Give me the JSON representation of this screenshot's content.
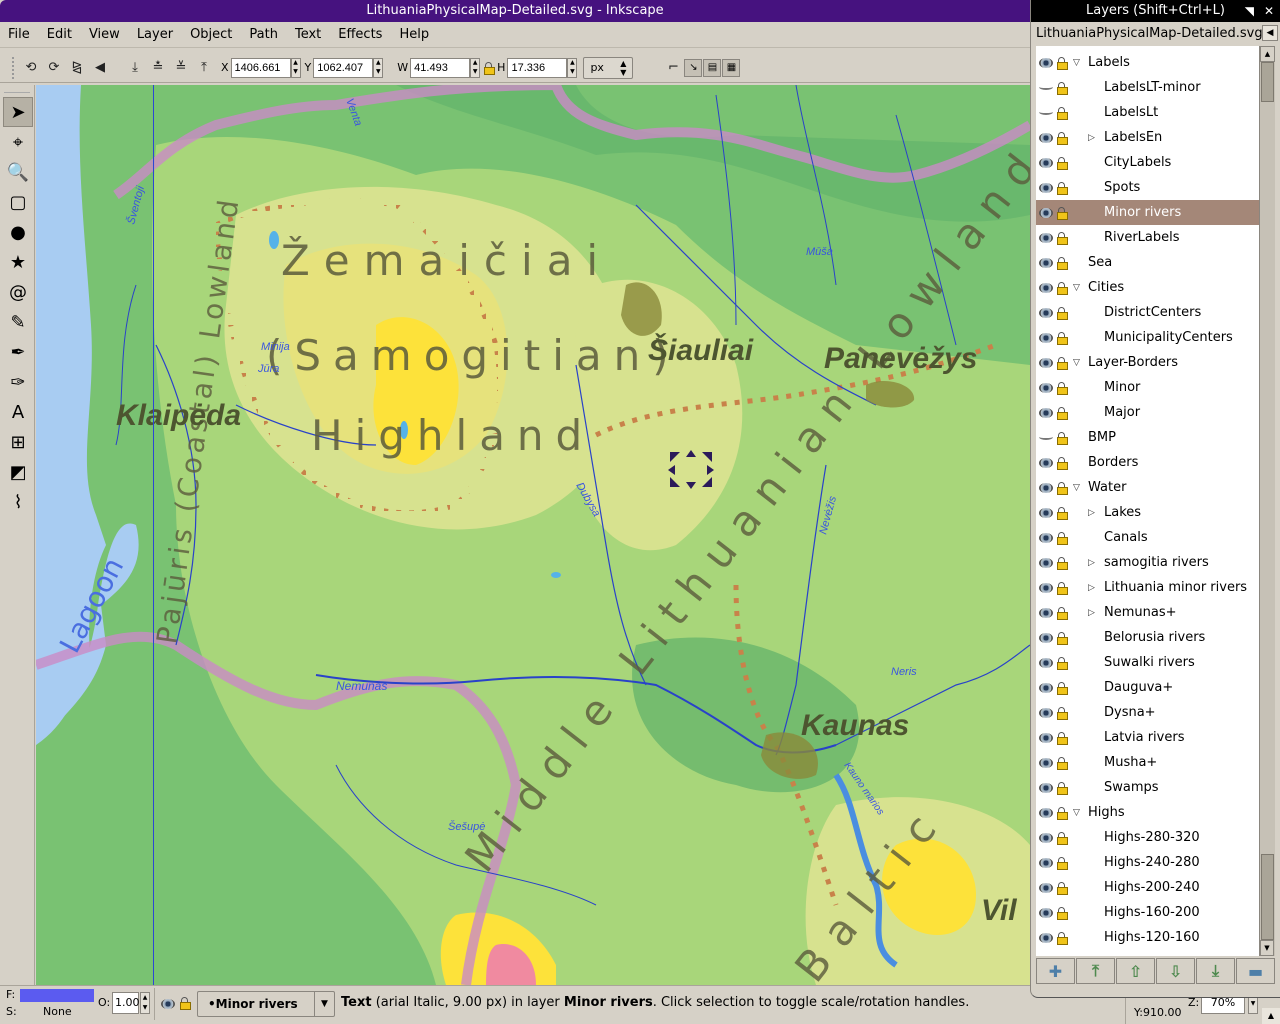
{
  "window": {
    "title": "LithuaniaPhysicalMap-Detailed.svg - Inkscape"
  },
  "menu": [
    {
      "label": "File",
      "accel": "F"
    },
    {
      "label": "Edit",
      "accel": "E"
    },
    {
      "label": "View",
      "accel": "V"
    },
    {
      "label": "Layer",
      "accel": "L"
    },
    {
      "label": "Object",
      "accel": "O"
    },
    {
      "label": "Path",
      "accel": "P"
    },
    {
      "label": "Text",
      "accel": "T"
    },
    {
      "label": "Effects",
      "accel": ""
    },
    {
      "label": "Help",
      "accel": "H"
    }
  ],
  "toolbar": {
    "x_label": "X",
    "x_value": "1406.661",
    "y_label": "Y",
    "y_value": "1062.407",
    "w_label": "W",
    "w_value": "41.493",
    "h_label": "H",
    "h_value": "17.336",
    "unit": "px",
    "transform_icons": [
      "rotate-ccw-icon",
      "rotate-cw-icon",
      "flip-horizontal-icon",
      "flip-vertical-icon"
    ],
    "zorder_icons": [
      "lower-to-bottom-icon",
      "lower-icon",
      "raise-icon",
      "raise-to-top-icon"
    ],
    "snap_icons": [
      "scale-stroke-icon",
      "scale-corners-icon",
      "scale-gradients-icon",
      "scale-patterns-icon"
    ]
  },
  "tools": [
    {
      "name": "selector-tool",
      "glyph": "➤",
      "active": true
    },
    {
      "name": "node-tool",
      "glyph": "⌖"
    },
    {
      "name": "zoom-tool",
      "glyph": "🔍"
    },
    {
      "name": "rectangle-tool",
      "glyph": "▢"
    },
    {
      "name": "ellipse-tool",
      "glyph": "●"
    },
    {
      "name": "star-tool",
      "glyph": "★"
    },
    {
      "name": "spiral-tool",
      "glyph": "@"
    },
    {
      "name": "pencil-tool",
      "glyph": "✎"
    },
    {
      "name": "pen-tool",
      "glyph": "✒"
    },
    {
      "name": "calligraphy-tool",
      "glyph": "✑"
    },
    {
      "name": "text-tool",
      "glyph": "A"
    },
    {
      "name": "connector-tool",
      "glyph": "⊞"
    },
    {
      "name": "gradient-tool",
      "glyph": "◩"
    },
    {
      "name": "dropper-tool",
      "glyph": "⌇"
    }
  ],
  "layers_dock": {
    "title": "Layers (Shift+Ctrl+L)",
    "document": "LithuaniaPhysicalMap-Detailed.svg",
    "layers": [
      {
        "name": "Labels",
        "level": 0,
        "expander": "open",
        "visible": true
      },
      {
        "name": "LabelsLT-minor",
        "level": 1,
        "expander": "",
        "visible": false
      },
      {
        "name": "LabelsLt",
        "level": 1,
        "expander": "",
        "visible": false
      },
      {
        "name": "LabelsEn",
        "level": 1,
        "expander": "closed",
        "visible": true
      },
      {
        "name": "CityLabels",
        "level": 1,
        "expander": "",
        "visible": true
      },
      {
        "name": "Spots",
        "level": 1,
        "expander": "",
        "visible": true
      },
      {
        "name": "Minor rivers",
        "level": 1,
        "expander": "",
        "visible": true,
        "selected": true
      },
      {
        "name": "RiverLabels",
        "level": 1,
        "expander": "",
        "visible": true
      },
      {
        "name": "Sea",
        "level": 0,
        "expander": "",
        "visible": true
      },
      {
        "name": "Cities",
        "level": 0,
        "expander": "open",
        "visible": true
      },
      {
        "name": "DistrictCenters",
        "level": 1,
        "expander": "",
        "visible": true
      },
      {
        "name": "MunicipalityCenters",
        "level": 1,
        "expander": "",
        "visible": true
      },
      {
        "name": "Layer-Borders",
        "level": 0,
        "expander": "open",
        "visible": true
      },
      {
        "name": "Minor",
        "level": 1,
        "expander": "",
        "visible": true
      },
      {
        "name": "Major",
        "level": 1,
        "expander": "",
        "visible": true
      },
      {
        "name": "BMP",
        "level": 0,
        "expander": "",
        "visible": false
      },
      {
        "name": "Borders",
        "level": 0,
        "expander": "",
        "visible": true
      },
      {
        "name": "Water",
        "level": 0,
        "expander": "open",
        "visible": true
      },
      {
        "name": "Lakes",
        "level": 1,
        "expander": "closed",
        "visible": true
      },
      {
        "name": "Canals",
        "level": 1,
        "expander": "",
        "visible": true
      },
      {
        "name": "samogitia rivers",
        "level": 1,
        "expander": "closed",
        "visible": true
      },
      {
        "name": "Lithuania minor rivers",
        "level": 1,
        "expander": "closed",
        "visible": true
      },
      {
        "name": "Nemunas+",
        "level": 1,
        "expander": "closed",
        "visible": true
      },
      {
        "name": "Belorusia rivers",
        "level": 1,
        "expander": "",
        "visible": true
      },
      {
        "name": "Suwalki rivers",
        "level": 1,
        "expander": "",
        "visible": true
      },
      {
        "name": "Dauguva+",
        "level": 1,
        "expander": "",
        "visible": true
      },
      {
        "name": "Dysna+",
        "level": 1,
        "expander": "",
        "visible": true
      },
      {
        "name": "Latvia rivers",
        "level": 1,
        "expander": "",
        "visible": true
      },
      {
        "name": "Musha+",
        "level": 1,
        "expander": "",
        "visible": true
      },
      {
        "name": "Swamps",
        "level": 1,
        "expander": "",
        "visible": true
      },
      {
        "name": "Highs",
        "level": 0,
        "expander": "open",
        "visible": true
      },
      {
        "name": "Highs-280-320",
        "level": 1,
        "expander": "",
        "visible": true
      },
      {
        "name": "Highs-240-280",
        "level": 1,
        "expander": "",
        "visible": true
      },
      {
        "name": "Highs-200-240",
        "level": 1,
        "expander": "",
        "visible": true
      },
      {
        "name": "Highs-160-200",
        "level": 1,
        "expander": "",
        "visible": true
      },
      {
        "name": "Highs-120-160",
        "level": 1,
        "expander": "",
        "visible": true
      }
    ],
    "buttons": [
      {
        "name": "add-layer-button",
        "glyph": "✚"
      },
      {
        "name": "raise-layer-to-top-button",
        "glyph": "⤒"
      },
      {
        "name": "raise-layer-button",
        "glyph": "⇧"
      },
      {
        "name": "lower-layer-button",
        "glyph": "⇩"
      },
      {
        "name": "lower-layer-to-bottom-button",
        "glyph": "⤓"
      },
      {
        "name": "remove-layer-button",
        "glyph": "▬"
      }
    ]
  },
  "map": {
    "region_labels": [
      "Žemaičiai",
      "(Samogitian)",
      "Highland",
      "Middle Lithuanian Lowland",
      "Pajūris (Coastal) Lowland",
      "Baltic"
    ],
    "cities": [
      "Klaipėda",
      "Šiauliai",
      "Panevėžys",
      "Kaunas",
      "Vil"
    ],
    "lagoon": "Lagoon",
    "rivers": [
      "Nemunas",
      "Šešupė",
      "Neris",
      "Nevėžis",
      "Dubysa",
      "Minija",
      "Jūra",
      "Venta",
      "Mūša",
      "Šventoji",
      "Kauno marios"
    ],
    "colors": {
      "lowland": "#79c272",
      "lowland_dark": "#5fb06a",
      "plain": "#a8d67a",
      "upland": "#d7e28f",
      "highland": "#e6e27c",
      "peak": "#fde23a",
      "sea": "#a8ccf2",
      "border": "#c98bc6",
      "river": "#2942c9",
      "city": "#8a8a3a",
      "dotted_border": "#c8824a"
    }
  },
  "status": {
    "fill_label": "F:",
    "fill_color": "#5b5bf0",
    "stroke_label": "S:",
    "stroke_value": "None",
    "opacity_label": "O:",
    "opacity_value": "1.00",
    "current_layer": "•Minor rivers",
    "message_bold1": "Text",
    "message_part1": " (arial Italic, 9.00 px) in layer ",
    "message_bold2": "Minor rivers",
    "message_part2": ". Click selection to toggle scale/rotation handles.",
    "cursor_y": "Y:910.00",
    "zoom_label": "Z:",
    "zoom_value": "70%"
  }
}
